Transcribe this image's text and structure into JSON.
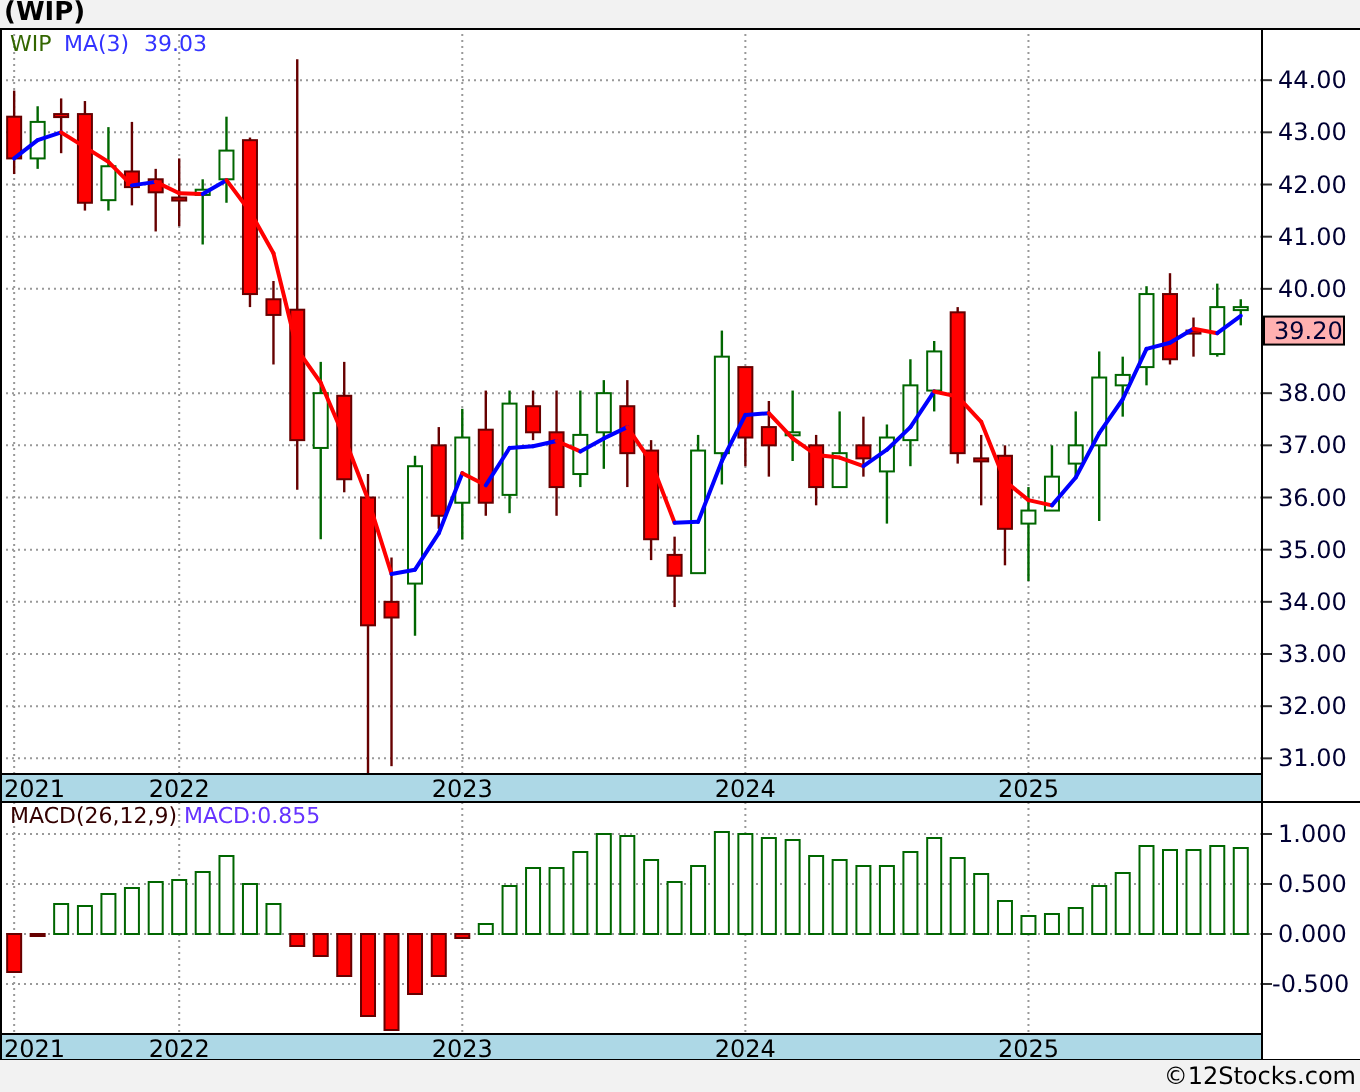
{
  "title": "(WIP)",
  "price_panel": {
    "legend": {
      "symbol": "WIP",
      "indicator": "MA(3)",
      "indicator_value": "39.03"
    },
    "last_price": "39.20",
    "first_date_label": "2021",
    "chart_data": {
      "type": "candlestick",
      "grid": true,
      "xlim": [
        2021.367,
        2025.825
      ],
      "ylim": [
        30.7,
        45.0
      ],
      "x": [
        2021.417,
        2021.5,
        2021.583,
        2021.667,
        2021.75,
        2021.833,
        2021.917,
        2022.0,
        2022.083,
        2022.167,
        2022.25,
        2022.333,
        2022.417,
        2022.5,
        2022.583,
        2022.667,
        2022.75,
        2022.833,
        2022.917,
        2023.0,
        2023.083,
        2023.167,
        2023.25,
        2023.333,
        2023.417,
        2023.5,
        2023.583,
        2023.667,
        2023.75,
        2023.833,
        2023.917,
        2024.0,
        2024.083,
        2024.167,
        2024.25,
        2024.333,
        2024.417,
        2024.5,
        2024.583,
        2024.667,
        2024.75,
        2024.833,
        2024.917,
        2025.0,
        2025.083,
        2025.167,
        2025.25,
        2025.333,
        2025.417,
        2025.5,
        2025.583,
        2025.667,
        2025.75
      ],
      "xticks": [
        {
          "value": 2022,
          "label": "2022"
        },
        {
          "value": 2023,
          "label": "2023"
        },
        {
          "value": 2024,
          "label": "2024"
        },
        {
          "value": 2025,
          "label": "2025"
        }
      ],
      "yticks": [
        {
          "value": 31,
          "label": "31.00"
        },
        {
          "value": 32,
          "label": "32.00"
        },
        {
          "value": 33,
          "label": "33.00"
        },
        {
          "value": 34,
          "label": "34.00"
        },
        {
          "value": 35,
          "label": "35.00"
        },
        {
          "value": 36,
          "label": "36.00"
        },
        {
          "value": 37,
          "label": "37.00"
        },
        {
          "value": 38,
          "label": "38.00"
        },
        {
          "value": 40,
          "label": "40.00"
        },
        {
          "value": 41,
          "label": "41.00"
        },
        {
          "value": 42,
          "label": "42.00"
        },
        {
          "value": 43,
          "label": "43.00"
        },
        {
          "value": 44,
          "label": "44.00"
        }
      ],
      "ohlc": [
        [
          43.3,
          43.8,
          42.2,
          42.5
        ],
        [
          42.5,
          43.5,
          42.3,
          43.2
        ],
        [
          43.35,
          43.65,
          42.6,
          43.3
        ],
        [
          43.35,
          43.6,
          41.5,
          41.65
        ],
        [
          41.7,
          43.1,
          41.5,
          42.35
        ],
        [
          42.25,
          43.2,
          41.6,
          41.95
        ],
        [
          42.1,
          42.3,
          41.1,
          41.85
        ],
        [
          41.75,
          42.5,
          41.2,
          41.7
        ],
        [
          41.8,
          42.1,
          40.85,
          41.9
        ],
        [
          42.1,
          43.3,
          41.65,
          42.65
        ],
        [
          42.85,
          42.9,
          39.65,
          39.9
        ],
        [
          39.8,
          40.15,
          38.55,
          39.5
        ],
        [
          39.6,
          44.4,
          36.15,
          37.1
        ],
        [
          36.95,
          38.6,
          35.2,
          38.0
        ],
        [
          37.95,
          38.6,
          36.1,
          36.35
        ],
        [
          36.0,
          36.45,
          30.7,
          33.55
        ],
        [
          34.0,
          34.85,
          30.85,
          33.7
        ],
        [
          34.35,
          36.8,
          33.35,
          36.6
        ],
        [
          37.0,
          37.35,
          35.4,
          35.65
        ],
        [
          35.9,
          37.7,
          35.2,
          37.15
        ],
        [
          37.3,
          38.05,
          35.65,
          35.9
        ],
        [
          36.05,
          38.05,
          35.7,
          37.8
        ],
        [
          37.75,
          38.05,
          37.1,
          37.25
        ],
        [
          37.25,
          38.05,
          35.65,
          36.2
        ],
        [
          36.45,
          38.05,
          36.2,
          37.2
        ],
        [
          37.25,
          38.25,
          36.55,
          38.0
        ],
        [
          37.75,
          38.25,
          36.2,
          36.85
        ],
        [
          36.9,
          37.1,
          34.8,
          35.2
        ],
        [
          34.9,
          35.25,
          33.9,
          34.5
        ],
        [
          34.55,
          37.2,
          34.55,
          36.9
        ],
        [
          36.85,
          39.2,
          36.25,
          38.7
        ],
        [
          38.5,
          38.5,
          36.6,
          37.15
        ],
        [
          37.35,
          37.85,
          36.4,
          37.0
        ],
        [
          37.2,
          38.05,
          36.7,
          37.25
        ],
        [
          37.0,
          37.2,
          35.85,
          36.2
        ],
        [
          36.2,
          37.65,
          36.2,
          36.85
        ],
        [
          37.0,
          37.55,
          36.4,
          36.75
        ],
        [
          36.5,
          37.4,
          35.5,
          37.15
        ],
        [
          37.1,
          38.65,
          36.6,
          38.15
        ],
        [
          38.05,
          39.0,
          37.65,
          38.8
        ],
        [
          39.55,
          39.65,
          36.65,
          36.85
        ],
        [
          36.75,
          37.2,
          35.85,
          36.7
        ],
        [
          36.8,
          37.0,
          34.7,
          35.4
        ],
        [
          35.5,
          36.2,
          34.4,
          35.75
        ],
        [
          35.75,
          37.0,
          35.75,
          36.4
        ],
        [
          36.65,
          37.65,
          36.4,
          37.0
        ],
        [
          37.0,
          38.8,
          35.55,
          38.3
        ],
        [
          38.15,
          38.7,
          37.55,
          38.35
        ],
        [
          38.5,
          40.05,
          38.15,
          39.9
        ],
        [
          39.9,
          40.3,
          38.55,
          38.65
        ],
        [
          39.2,
          39.45,
          38.7,
          39.15
        ],
        [
          38.75,
          40.1,
          38.7,
          39.65
        ],
        [
          39.6,
          39.8,
          39.3,
          39.65
        ]
      ]
    }
  },
  "macd_panel": {
    "legend": {
      "indicator": "MACD(26,12,9)",
      "reading": "MACD:0.855"
    },
    "first_date_label": "2021",
    "chart_data": {
      "type": "bar",
      "grid": true,
      "xlim": [
        2021.367,
        2025.825
      ],
      "ylim": [
        -1.0,
        1.32
      ],
      "x": [
        2021.417,
        2021.5,
        2021.583,
        2021.667,
        2021.75,
        2021.833,
        2021.917,
        2022.0,
        2022.083,
        2022.167,
        2022.25,
        2022.333,
        2022.417,
        2022.5,
        2022.583,
        2022.667,
        2022.75,
        2022.833,
        2022.917,
        2023.0,
        2023.083,
        2023.167,
        2023.25,
        2023.333,
        2023.417,
        2023.5,
        2023.583,
        2023.667,
        2023.75,
        2023.833,
        2023.917,
        2024.0,
        2024.083,
        2024.167,
        2024.25,
        2024.333,
        2024.417,
        2024.5,
        2024.583,
        2024.667,
        2024.75,
        2024.833,
        2024.917,
        2025.0,
        2025.083,
        2025.167,
        2025.25,
        2025.333,
        2025.417,
        2025.5,
        2025.583,
        2025.667,
        2025.75
      ],
      "xticks": [
        {
          "value": 2022,
          "label": "2022"
        },
        {
          "value": 2023,
          "label": "2023"
        },
        {
          "value": 2024,
          "label": "2024"
        },
        {
          "value": 2025,
          "label": "2025"
        }
      ],
      "yticks": [
        {
          "value": -0.5,
          "label": "-0.500"
        },
        {
          "value": 0,
          "label": "0.000"
        },
        {
          "value": 0.5,
          "label": "0.500"
        },
        {
          "value": 1,
          "label": "1.000"
        }
      ],
      "values": [
        -0.38,
        -0.01,
        0.3,
        0.28,
        0.4,
        0.46,
        0.52,
        0.54,
        0.62,
        0.78,
        0.5,
        0.3,
        -0.12,
        -0.22,
        -0.42,
        -0.82,
        -0.96,
        -0.6,
        -0.42,
        -0.04,
        0.1,
        0.48,
        0.66,
        0.66,
        0.82,
        1.0,
        0.98,
        0.74,
        0.52,
        0.68,
        1.02,
        1.0,
        0.96,
        0.94,
        0.78,
        0.74,
        0.68,
        0.68,
        0.82,
        0.96,
        0.76,
        0.6,
        0.33,
        0.18,
        0.2,
        0.26,
        0.48,
        0.61,
        0.88,
        0.84,
        0.84,
        0.88,
        0.86
      ]
    }
  },
  "credit": "©12Stocks.com"
}
